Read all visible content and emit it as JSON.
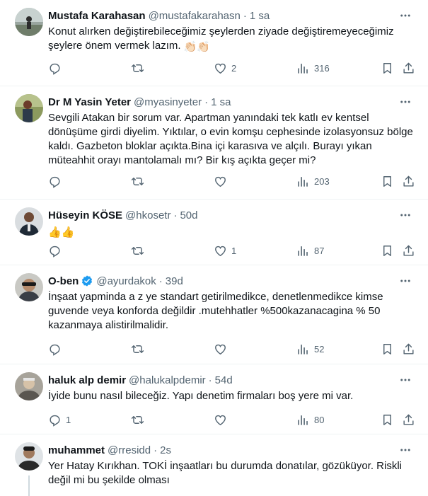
{
  "colors": {
    "text": "#0f1419",
    "muted": "#536471",
    "divider": "#eff3f4",
    "verified": "#1d9bf0"
  },
  "tweets": [
    {
      "name": "Mustafa Karahasan",
      "handle": "@mustafakarahasn",
      "dot": "·",
      "time": "1 sa",
      "text": "Konut alırken değiştirebileceğimiz şeylerden ziyade değiştiremeyeceğimiz şeylere önem vermek lazım.",
      "emoji": "👏🏻👏🏻",
      "verified": false,
      "reply_count": "",
      "retweet_count": "",
      "like_count": "2",
      "view_count": "316"
    },
    {
      "name": "Dr M Yasin Yeter",
      "handle": "@myasinyeter",
      "dot": "·",
      "time": "1 sa",
      "text": "Sevgili Atakan bir sorum var. Apartman yanındaki tek katlı ev kentsel dönüşüme girdi diyelim. Yıktılar, o evin komşu cephesinde izolasyonsuz bölge kaldı. Gazbeton bloklar açıkta.Bina içi karasıva ve alçılı. Burayı yıkan müteahhit orayı mantolamalı mı? Bir kış açıkta geçer mi?",
      "emoji": "",
      "verified": false,
      "reply_count": "",
      "retweet_count": "",
      "like_count": "",
      "view_count": "203"
    },
    {
      "name": "Hüseyin KÖSE",
      "handle": "@hkosetr",
      "dot": "·",
      "time": "50d",
      "text": "",
      "emoji": "👍👍",
      "verified": false,
      "reply_count": "",
      "retweet_count": "",
      "like_count": "1",
      "view_count": "87"
    },
    {
      "name": "O-ben",
      "handle": "@ayurdakok",
      "dot": "·",
      "time": "39d",
      "text": "İnşaat yapminda a z ye standart getirilmedikce, denetlenmedikce kimse guvende veya konforda değildir .mutehhatler %500kazanacagina % 50 kazanmaya alistirilmalidir.",
      "emoji": "",
      "verified": true,
      "reply_count": "",
      "retweet_count": "",
      "like_count": "",
      "view_count": "52"
    },
    {
      "name": "haluk alp demir",
      "handle": "@halukalpdemir",
      "dot": "·",
      "time": "54d",
      "text": "İyide bunu nasıl bileceğiz. Yapı denetim firmaları boş yere mi var.",
      "emoji": "",
      "verified": false,
      "reply_count": "1",
      "retweet_count": "",
      "like_count": "",
      "view_count": "80"
    },
    {
      "name": "muhammet",
      "handle": "@rresidd",
      "dot": "·",
      "time": "2s",
      "text": "Yer Hatay Kırıkhan. TOKİ inşaatları bu durumda donatılar, gözüküyor. Riskli değil mi bu şekilde olması",
      "emoji": "",
      "verified": false,
      "reply_count": "",
      "retweet_count": "",
      "like_count": "",
      "view_count": ""
    }
  ]
}
